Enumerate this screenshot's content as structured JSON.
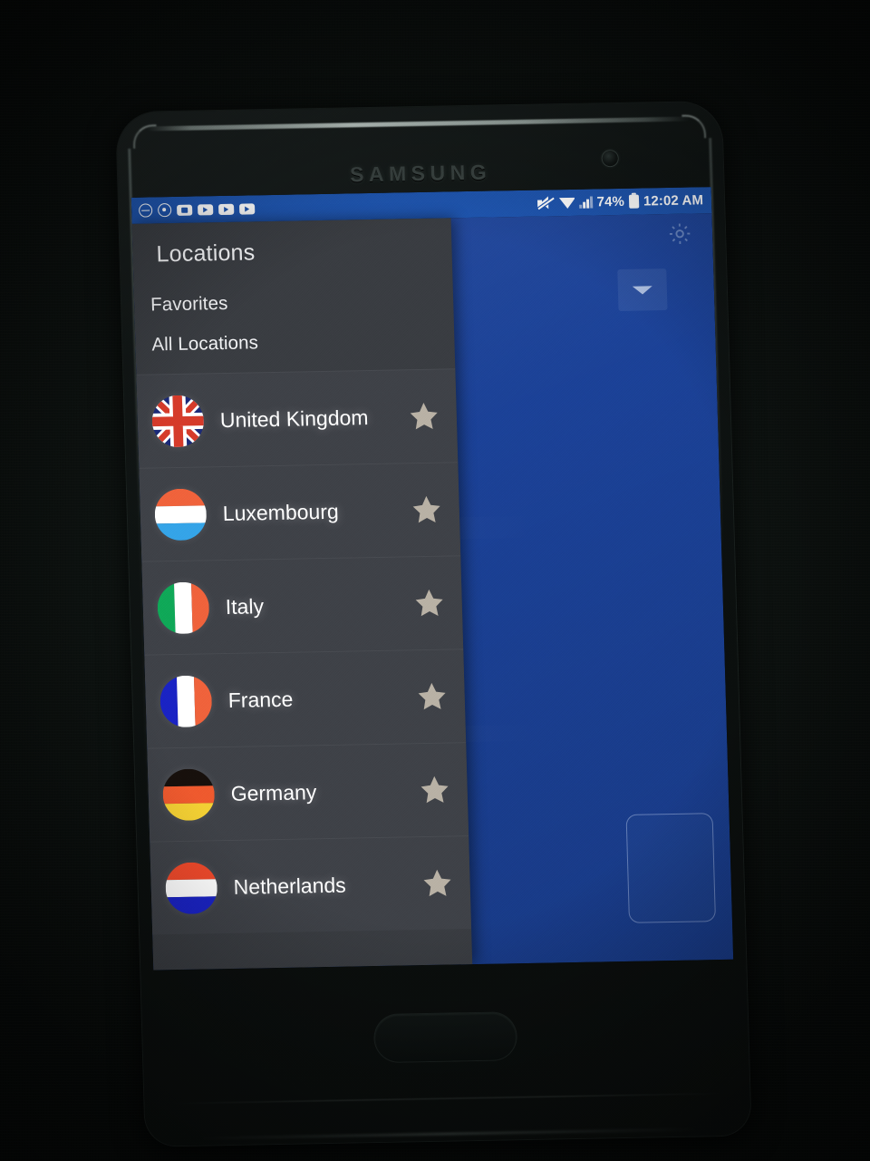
{
  "device": {
    "brand_label": "SAMSUNG",
    "camera_icon": "front-camera-icon",
    "home_button": "home-button"
  },
  "status_bar": {
    "background": "#1f56b0",
    "left_icons": [
      {
        "name": "do-not-disturb-icon"
      },
      {
        "name": "target-icon"
      },
      {
        "name": "notification-camera-icon"
      },
      {
        "name": "notification-video-icon"
      },
      {
        "name": "notification-video-icon"
      },
      {
        "name": "notification-video-icon"
      }
    ],
    "right_icons": [
      {
        "name": "mute-icon"
      },
      {
        "name": "wifi-icon"
      },
      {
        "name": "signal-icon"
      }
    ],
    "battery_percent": "74%",
    "battery_icon": "battery-icon",
    "clock": "12:02 AM"
  },
  "app": {
    "background": "#1b4298",
    "gear_icon": "gear-icon",
    "dropdown_icon": "chevron-down-icon",
    "outline_button": "outlined-action-button"
  },
  "drawer": {
    "background": "#3a3d42",
    "title": "Locations",
    "tabs": [
      {
        "label": "Favorites",
        "name": "drawer-tab-favorites"
      },
      {
        "label": "All Locations",
        "name": "drawer-tab-all-locations"
      }
    ],
    "star_color": "#b9b2a6",
    "locations": [
      {
        "name": "United Kingdom",
        "flag": "united-kingdom-flag",
        "favorited": false,
        "star_icon": "star-icon"
      },
      {
        "name": "Luxembourg",
        "flag": "luxembourg-flag",
        "favorited": false,
        "star_icon": "star-icon"
      },
      {
        "name": "Italy",
        "flag": "italy-flag",
        "favorited": false,
        "star_icon": "star-icon"
      },
      {
        "name": "France",
        "flag": "france-flag",
        "favorited": false,
        "star_icon": "star-icon"
      },
      {
        "name": "Germany",
        "flag": "germany-flag",
        "favorited": false,
        "star_icon": "star-icon"
      },
      {
        "name": "Netherlands",
        "flag": "netherlands-flag",
        "favorited": false,
        "star_icon": "star-icon"
      }
    ]
  }
}
